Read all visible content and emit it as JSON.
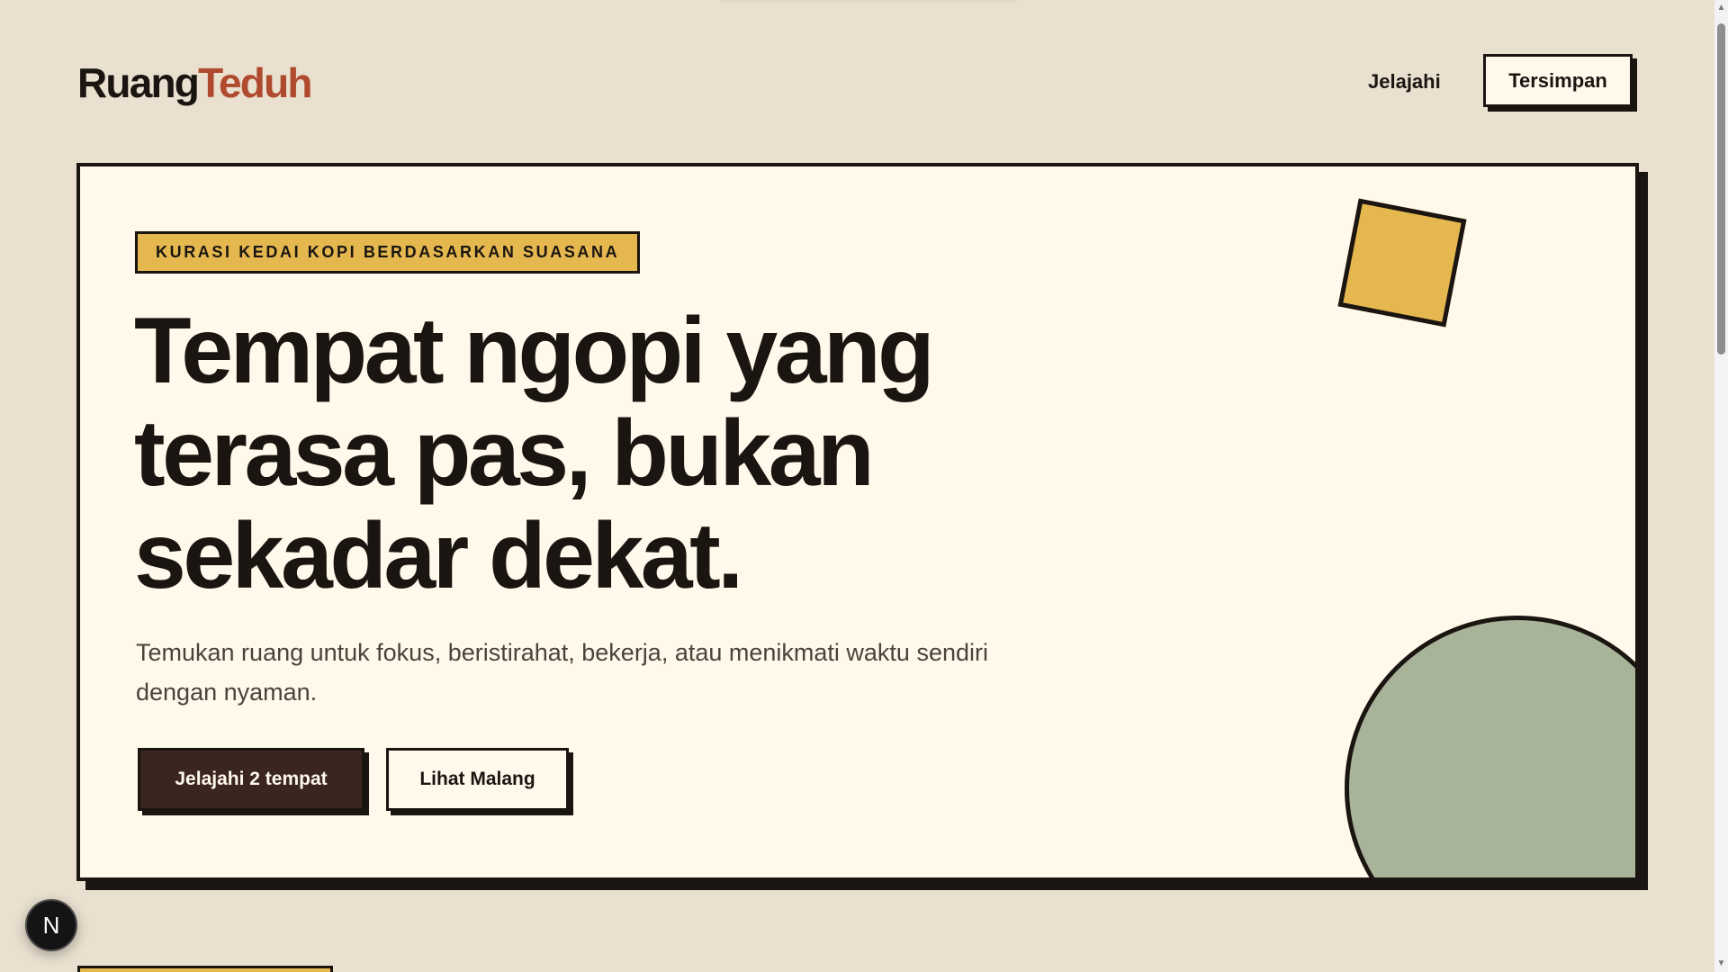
{
  "header": {
    "logo_part1": "Ruang",
    "logo_part2": "Teduh",
    "nav_explore": "Jelajahi",
    "saved_label": "Tersimpan"
  },
  "hero": {
    "eyebrow": "KURASI KEDAI KOPI BERDASARKAN SUASANA",
    "headline": "Tempat ngopi yang terasa pas, bukan sekadar dekat.",
    "subtitle": "Temukan ruang untuk fokus, beristirahat, bekerja, atau menikmati waktu sendiri dengan nyaman.",
    "primary_cta": "Jelajahi 2 tempat",
    "secondary_cta": "Lihat Malang"
  },
  "dev_badge": {
    "label": "N"
  },
  "icons": {
    "scroll_up": "scroll-up-arrow",
    "scroll_down": "scroll-down-arrow"
  },
  "colors": {
    "page_background": "#e9e0cf",
    "card_background": "#fff9ec",
    "ink": "#1b1511",
    "accent_rust": "#b04a2e",
    "accent_mustard": "#e5b84f",
    "accent_sage": "#a8b49a",
    "primary_button": "#3a261f",
    "muted_text": "#4b4239"
  }
}
